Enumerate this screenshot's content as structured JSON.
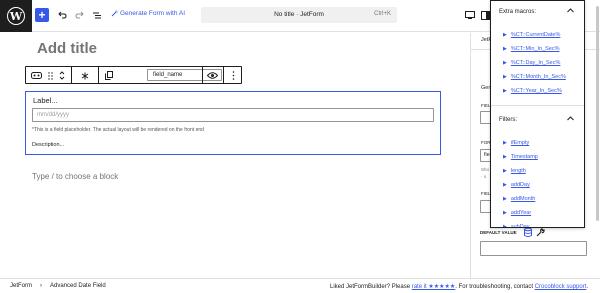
{
  "topbar": {
    "add_icon": "plus-icon",
    "generate_ai_label": "Generate Form with AI",
    "doc_title": "No title · JetForm",
    "shortcut": "Ctrl+K"
  },
  "editor": {
    "title_placeholder": "Add title",
    "field_name_value": "field_name",
    "field": {
      "label": "Label...",
      "placeholder": "mm/dd/yyyy",
      "hint": "*This is a field placeholder. The actual layout will be rendered on the front end",
      "description": "Description..."
    },
    "choose_block": "Type / to choose a block"
  },
  "sidebar": {
    "tab_partial": "JetF",
    "general_partial": "Gene",
    "field_partial_1": "FIEL",
    "form_partial": "FORM",
    "field_value_partial": "fie",
    "show_partial_1": "Sho",
    "show_partial_2": "· o",
    "field_partial_2": "FIEL",
    "default_value_label": "DEFAULT VALUE"
  },
  "macros_popup": {
    "extra_title": "Extra macros:",
    "extra_items": [
      "%CT::CurrentDate%",
      "%CT::Min_In_Sec%",
      "%CT::Day_In_Sec%",
      "%CT::Month_In_Sec%",
      "%CT::Year_In_Sec%"
    ],
    "filters_title": "Filters:",
    "filter_items": [
      "ifEmpty",
      "Timestamp",
      "length",
      "addDay",
      "addMonth",
      "addYear",
      "subDay"
    ]
  },
  "footer": {
    "crumb_1": "JetForm",
    "crumb_sep": "›",
    "crumb_2": "Advanced Date Field",
    "rate_text_1": "Liked JetFormBuilder? Please",
    "rate_link": "rate it ★★★★★",
    "rate_text_2": ". For troubleshooting, contact",
    "support_link": "Crocoblock support",
    "rate_text_3": "."
  },
  "colors": {
    "accent": "#3858e9",
    "dark": "#1e1e1e",
    "muted": "#757575"
  }
}
